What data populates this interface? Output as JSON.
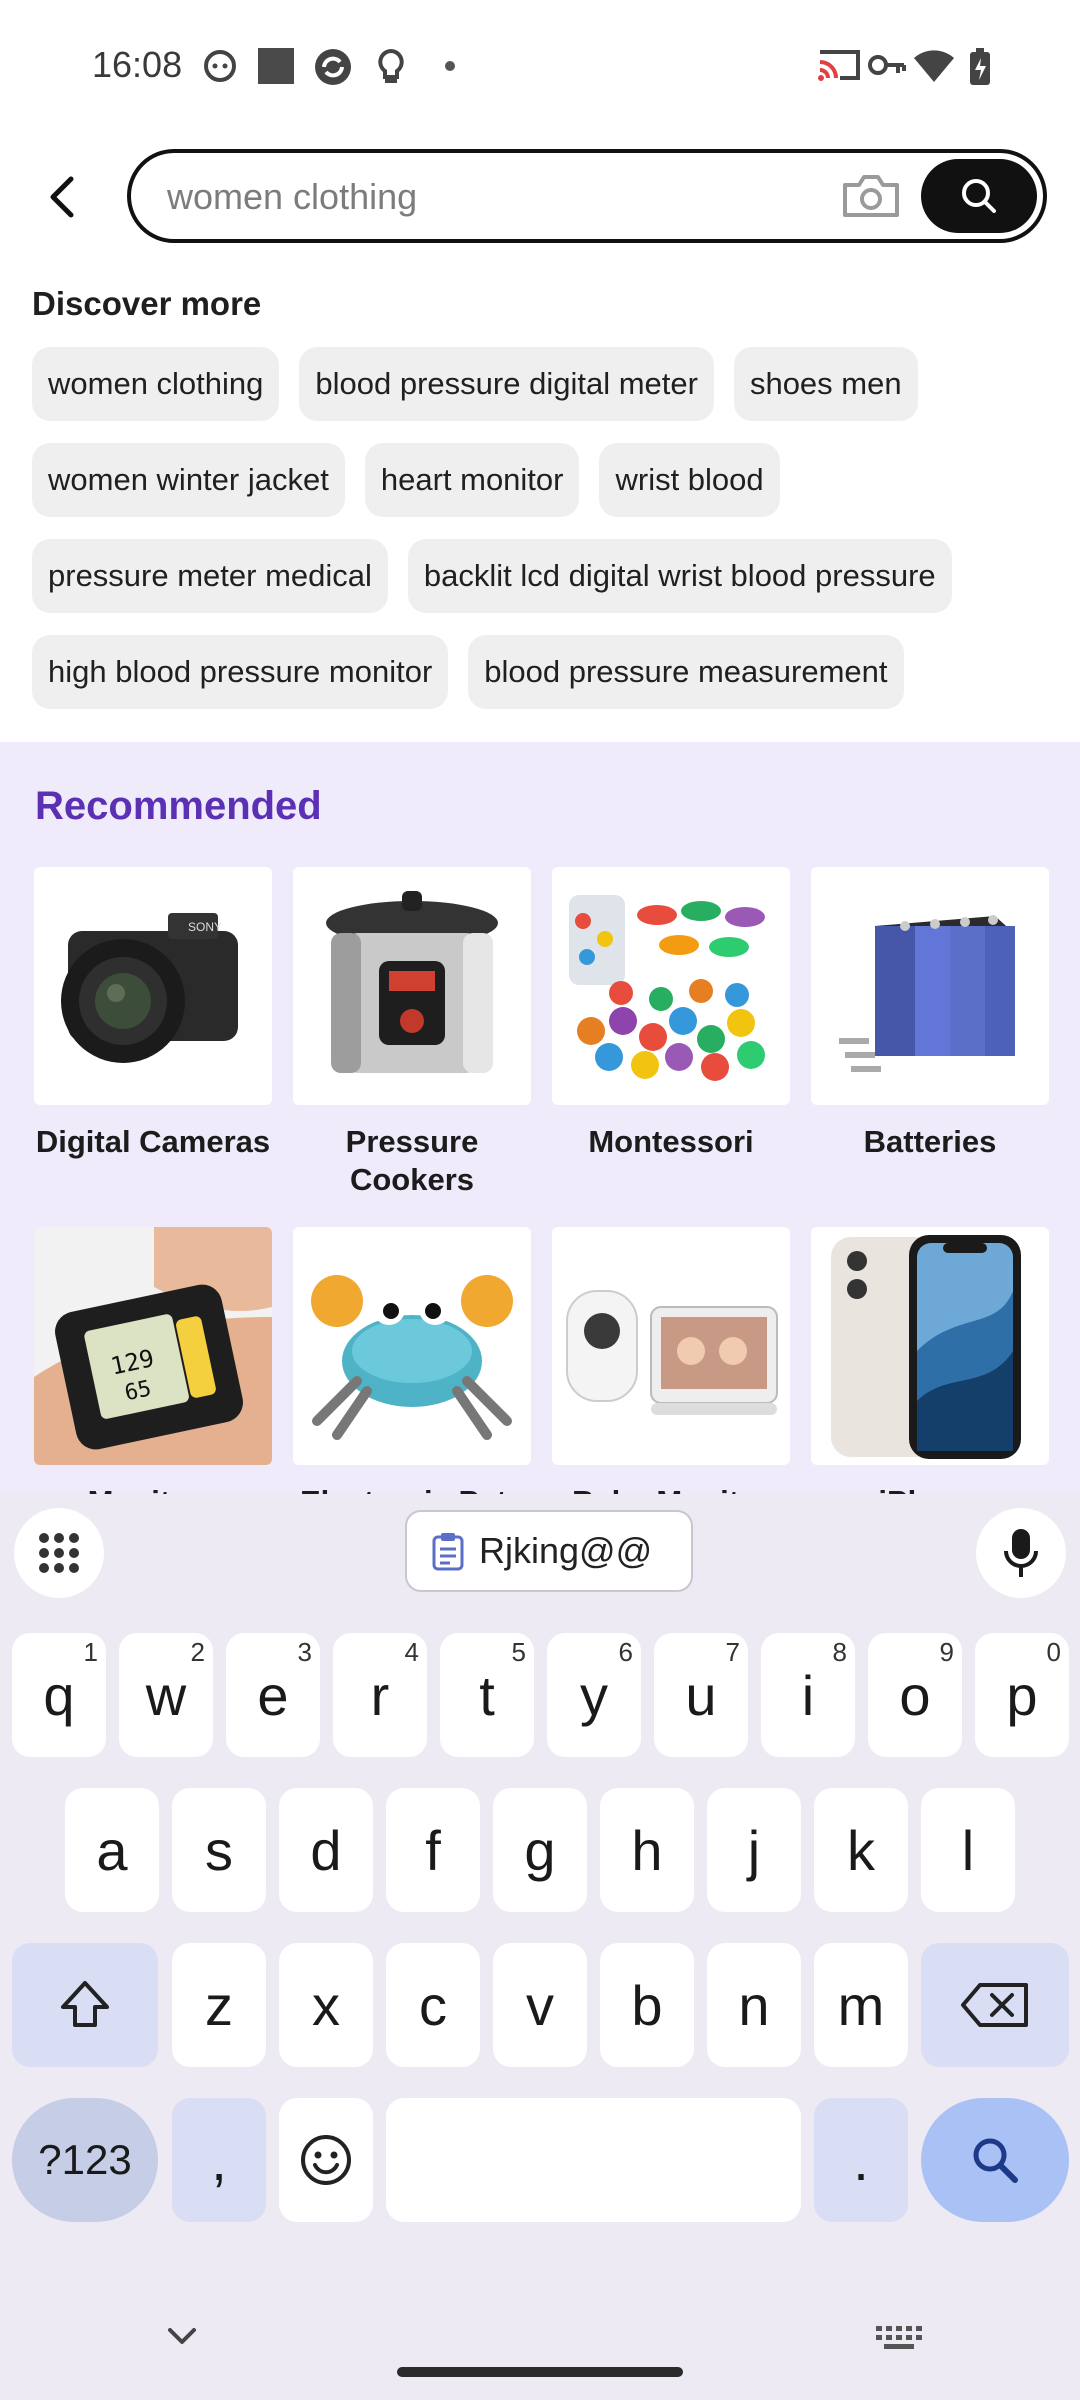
{
  "status_bar": {
    "time": "16:08",
    "left_icons": [
      "cat-face-icon",
      "square-icon",
      "sync-app-icon",
      "lightbulb-icon",
      "dot-icon"
    ],
    "right_icons": [
      "cast-icon",
      "key-icon",
      "wifi-icon",
      "battery-charging-icon"
    ]
  },
  "search": {
    "back_icon": "chevron-left-icon",
    "value": "women clothing",
    "camera_icon": "camera-icon",
    "search_icon": "search-icon"
  },
  "discover": {
    "title": "Discover more",
    "rows": [
      [
        "women clothing",
        "blood pressure digital meter",
        "shoes men"
      ],
      [
        "women winter jacket",
        "heart monitor",
        "wrist blood"
      ],
      [
        "pressure meter medical",
        "backlit lcd digital wrist blood pressure"
      ],
      [
        "high blood pressure monitor",
        "blood pressure measurement"
      ]
    ]
  },
  "recommended": {
    "title": "Recommended",
    "items": [
      {
        "label": "Digital Cameras",
        "image": "camera-photo"
      },
      {
        "label": "Pressure Cookers",
        "image": "pressure-cooker-photo"
      },
      {
        "label": "Montessori",
        "image": "colorful-toys-photo"
      },
      {
        "label": "Batteries",
        "image": "battery-pack-photo"
      },
      {
        "label": "Monitors",
        "image": "wrist-monitor-photo"
      },
      {
        "label": "Electronic Pets",
        "image": "crab-toy-photo"
      },
      {
        "label": "Baby Monitor",
        "image": "baby-monitor-photo"
      },
      {
        "label": "iPhone",
        "image": "iphone-photo"
      }
    ]
  },
  "keyboard": {
    "clipboard_suggestion": "Rjking@@",
    "row1": [
      {
        "k": "q",
        "s": "1"
      },
      {
        "k": "w",
        "s": "2"
      },
      {
        "k": "e",
        "s": "3"
      },
      {
        "k": "r",
        "s": "4"
      },
      {
        "k": "t",
        "s": "5"
      },
      {
        "k": "y",
        "s": "6"
      },
      {
        "k": "u",
        "s": "7"
      },
      {
        "k": "i",
        "s": "8"
      },
      {
        "k": "o",
        "s": "9"
      },
      {
        "k": "p",
        "s": "0"
      }
    ],
    "row2": [
      "a",
      "s",
      "d",
      "f",
      "g",
      "h",
      "j",
      "k",
      "l"
    ],
    "row3": [
      "z",
      "x",
      "c",
      "v",
      "b",
      "n",
      "m"
    ],
    "symbols_label": "?123",
    "comma": ",",
    "period": "."
  },
  "colors": {
    "accent": "#5b30b5",
    "recommended_bg": "#efebfa",
    "keyboard_bg": "#edeaf3",
    "search_key": "#a9c1f5"
  }
}
